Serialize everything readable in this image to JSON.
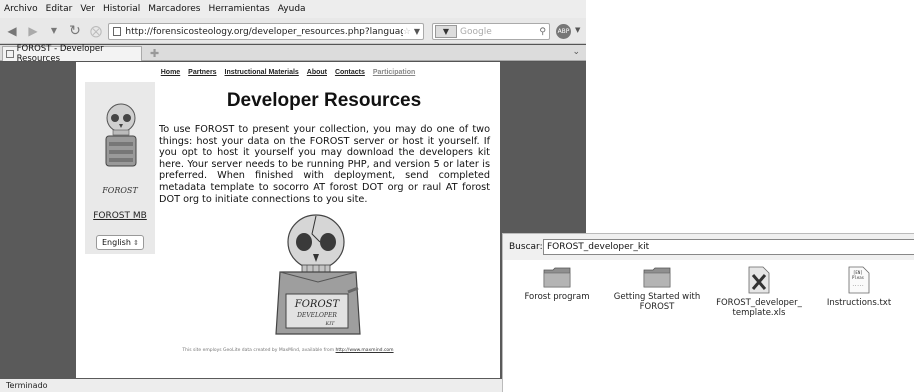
{
  "menu": {
    "items": [
      "Archivo",
      "Editar",
      "Ver",
      "Historial",
      "Marcadores",
      "Herramientas",
      "Ayuda"
    ]
  },
  "nav": {
    "url": "http://forensicosteology.org/developer_resources.php?language=en",
    "search_placeholder": "Google",
    "abp_label": "ABP"
  },
  "tabs": [
    {
      "label": "FOROST - Developer Resources"
    }
  ],
  "page": {
    "site_nav": [
      "Home",
      "Partners",
      "Instructional Materials",
      "About",
      "Contacts",
      "Participation"
    ],
    "title": "Developer Resources",
    "forost_caption": "FOROST",
    "forost_mb": "FOROST MB",
    "language": "English",
    "body": "To use FOROST to present your collection, you may do one of two things: host your data on the FOROST server or host it yourself. If you opt to host it yourself you may download the developers kit here. Your server needs to be running PHP, and version 5 or later is preferred. When finished with deployment, send completed metadata template to socorro AT forost DOT org or raul AT forost DOT org to initiate connections to you site.",
    "kit_label_1": "FOROST",
    "kit_label_2": "DEVELOPER",
    "kit_label_3": "KIT",
    "footer_text": "This site employs GeoLite data created by MaxMind, available from",
    "footer_link": "http://www.maxmind.com"
  },
  "status": {
    "text": "Terminado"
  },
  "file_browser": {
    "search_label": "Buscar:",
    "search_value": "FOROST_developer_kit",
    "items": [
      {
        "name": "Forost program",
        "type": "folder-icon"
      },
      {
        "name": "Getting Started with FOROST",
        "type": "folder-icon"
      },
      {
        "name": "FOROST_developer_ template.xls",
        "type": "spreadsheet-icon"
      },
      {
        "name": "Instructions.txt",
        "type": "text-file-icon"
      }
    ],
    "txt_icon_text": "[EN]\nPleas\n....."
  }
}
